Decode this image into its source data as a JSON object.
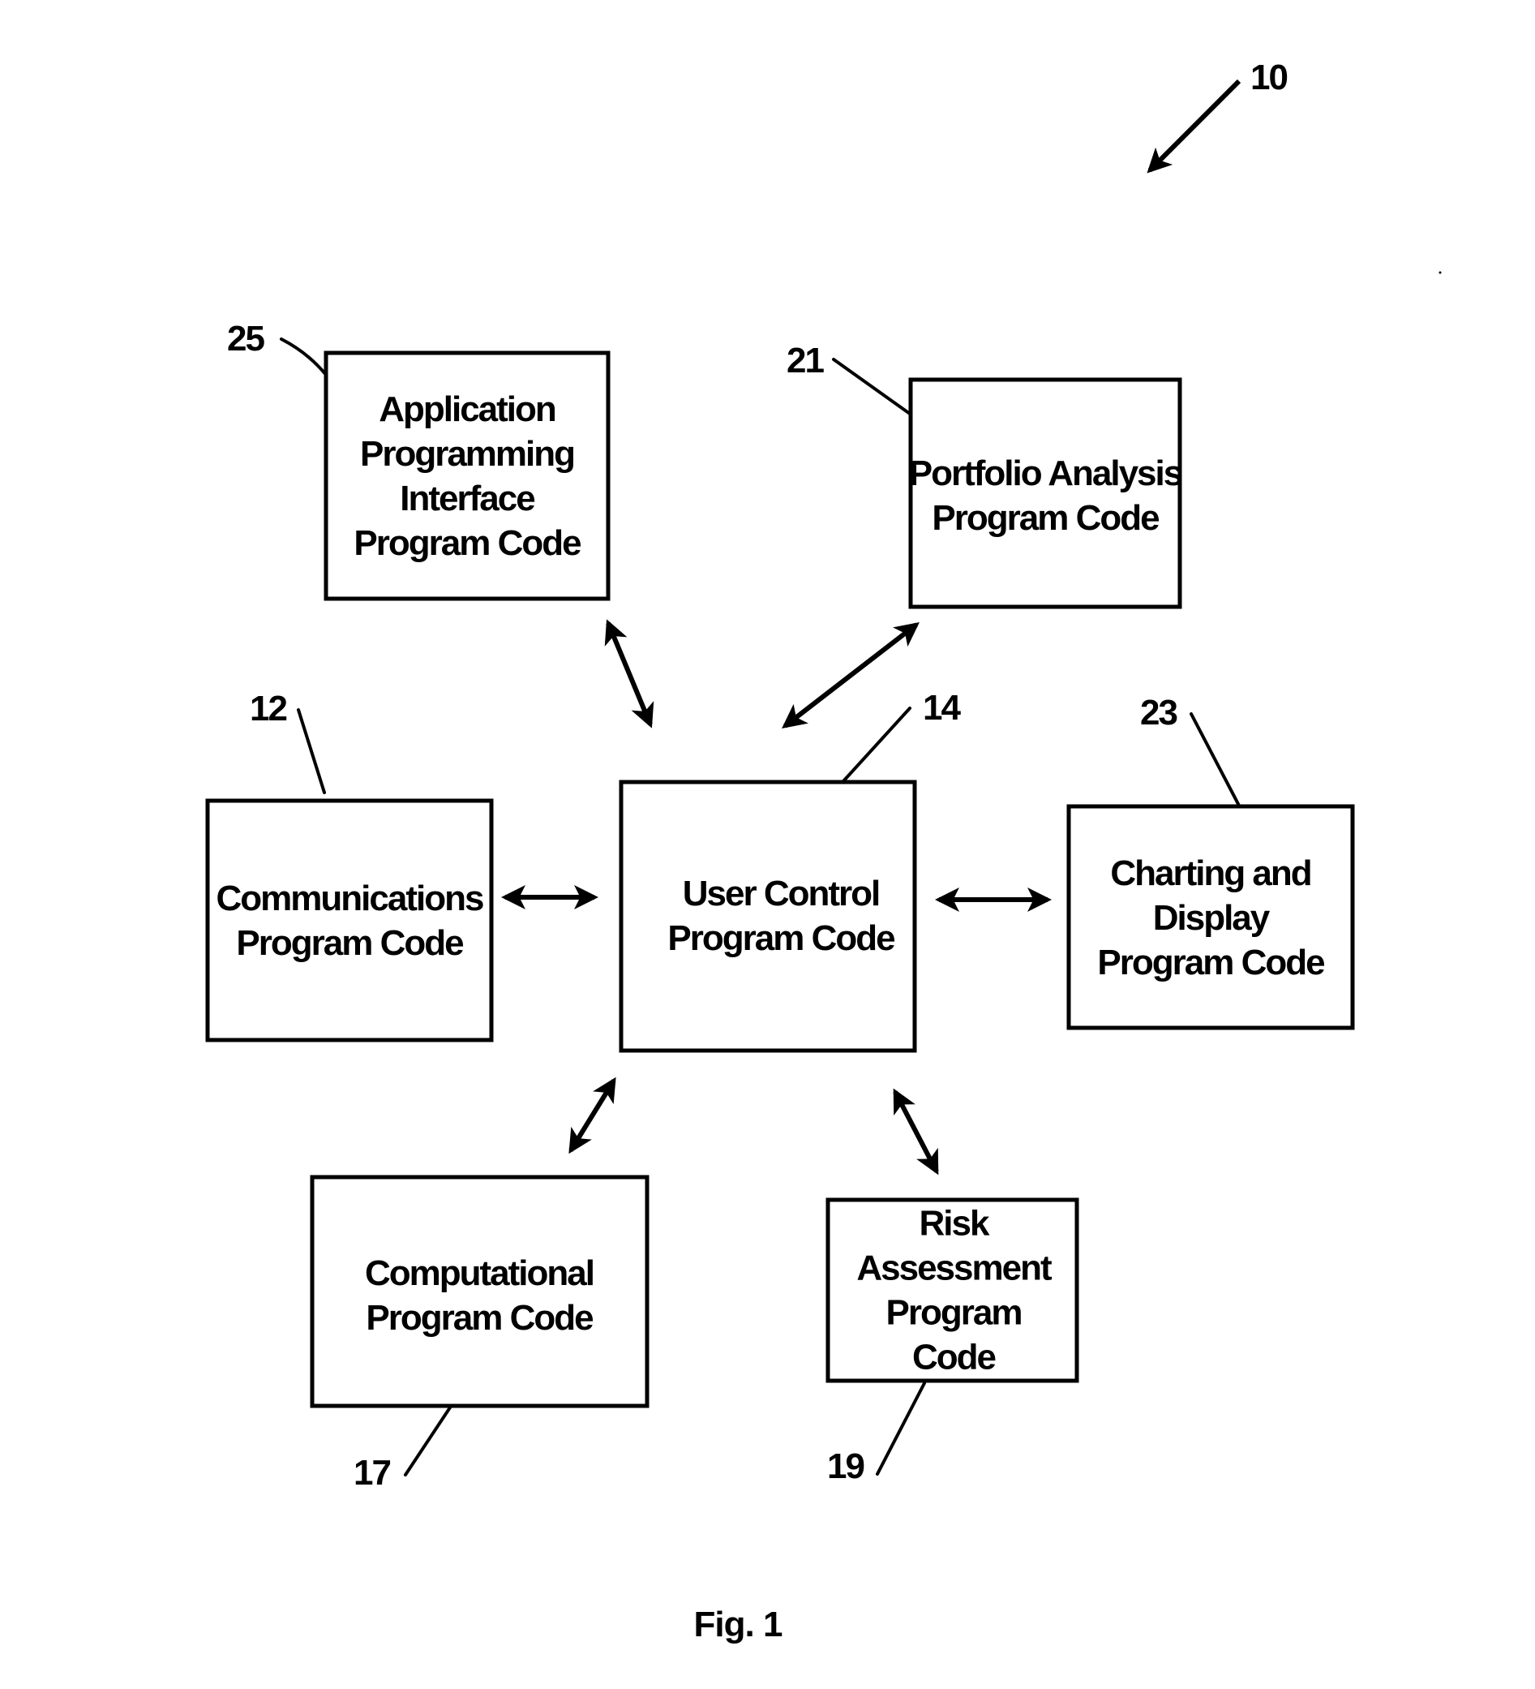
{
  "figure": {
    "caption": "Fig. 1",
    "system_ref": "10"
  },
  "boxes": {
    "api": {
      "ref": "25",
      "lines": [
        "Application",
        "Programming",
        "Interface",
        "Program Code"
      ]
    },
    "portfolio": {
      "ref": "21",
      "lines": [
        "Portfolio Analysis",
        "Program Code"
      ]
    },
    "communications": {
      "ref": "12",
      "lines": [
        "Communications",
        "Program Code"
      ]
    },
    "user_control": {
      "ref": "14",
      "lines": [
        "User Control",
        "Program Code"
      ]
    },
    "charting": {
      "ref": "23",
      "lines": [
        "Charting and",
        "Display",
        "Program Code"
      ]
    },
    "computational": {
      "ref": "17",
      "lines": [
        "Computational",
        "Program Code"
      ]
    },
    "risk": {
      "ref": "19",
      "lines": [
        "Risk",
        "Assessment",
        "Program",
        "Code"
      ]
    }
  },
  "connections": [
    {
      "from": "user_control",
      "to": "api",
      "type": "bidirectional"
    },
    {
      "from": "user_control",
      "to": "portfolio",
      "type": "bidirectional"
    },
    {
      "from": "user_control",
      "to": "communications",
      "type": "bidirectional"
    },
    {
      "from": "user_control",
      "to": "charting",
      "type": "bidirectional"
    },
    {
      "from": "user_control",
      "to": "computational",
      "type": "bidirectional"
    },
    {
      "from": "user_control",
      "to": "risk",
      "type": "bidirectional"
    }
  ]
}
